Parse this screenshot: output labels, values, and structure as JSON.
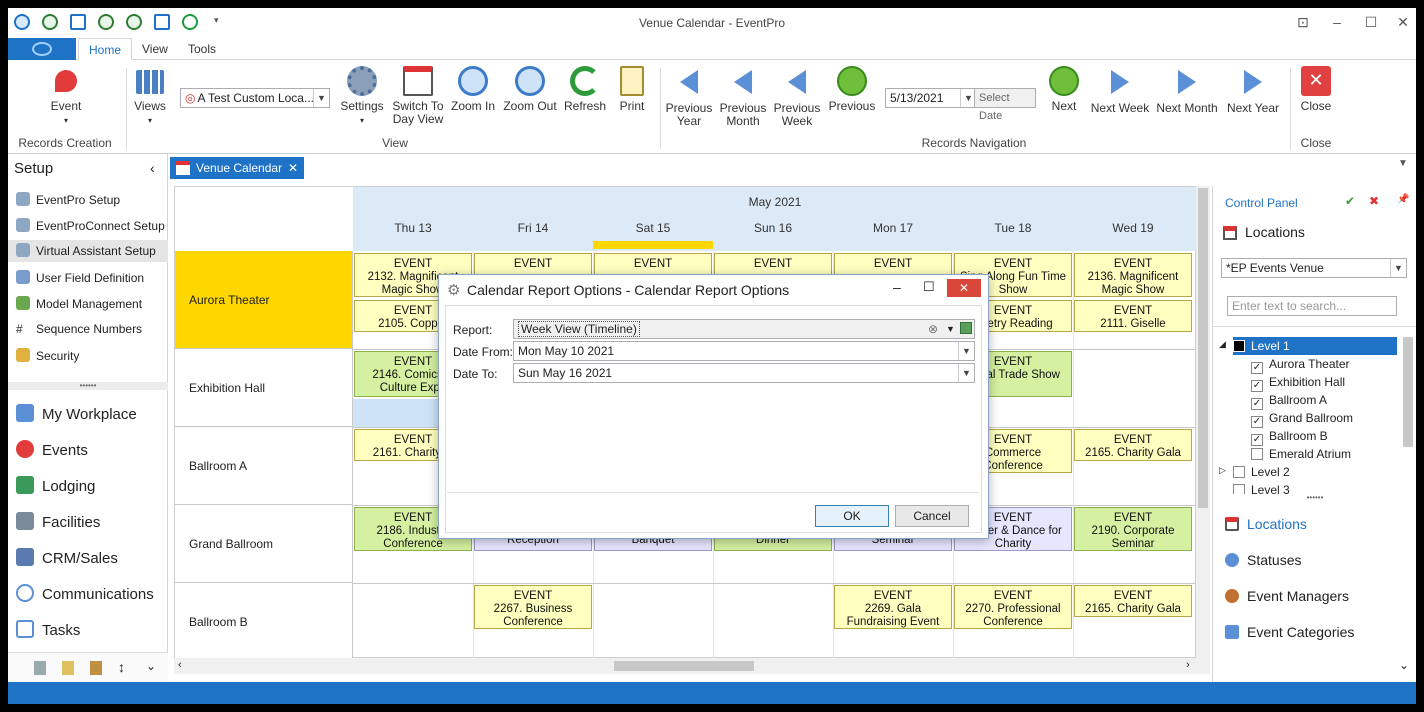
{
  "window": {
    "title": "Venue Calendar - EventPro"
  },
  "tabs": [
    "Home",
    "View",
    "Tools"
  ],
  "ribbon": {
    "event": "Event",
    "views": "Views",
    "view_combo": "A Test Custom Loca...",
    "settings": "Settings",
    "switch_to": "Switch To",
    "day_view": "Day View",
    "zoom_in": "Zoom In",
    "zoom_out": "Zoom Out",
    "refresh": "Refresh",
    "print": "Print",
    "prev_year_1": "Previous",
    "prev_year_2": "Year",
    "prev_month_1": "Previous",
    "prev_month_2": "Month",
    "prev_week_1": "Previous",
    "prev_week_2": "Week",
    "previous": "Previous",
    "date": "5/13/2021",
    "select_date": "Select Date",
    "next": "Next",
    "next_week": "Next Week",
    "next_month": "Next Month",
    "next_year": "Next Year",
    "close": "Close",
    "groups": {
      "records_creation": "Records Creation",
      "view": "View",
      "records_navigation": "Records Navigation",
      "close": "Close"
    }
  },
  "left_panel": {
    "title": "Setup",
    "setup_items": [
      "EventPro Setup",
      "EventProConnect Setup",
      "Virtual Assistant Setup",
      "User Field Definition",
      "Model Management",
      "Sequence Numbers",
      "Security"
    ],
    "nav_items": [
      "My Workplace",
      "Events",
      "Lodging",
      "Facilities",
      "CRM/Sales",
      "Communications",
      "Tasks"
    ]
  },
  "doc_tab": "Venue Calendar",
  "calendar": {
    "month": "May 2021",
    "days": [
      "Thu 13",
      "Fri 14",
      "Sat 15",
      "Sun 16",
      "Mon 17",
      "Tue 18",
      "Wed 19"
    ],
    "venues": [
      "Aurora Theater",
      "Exhibition Hall",
      "Ballroom A",
      "Grand Ballroom",
      "Ballroom B"
    ],
    "label": "EVENT",
    "events": {
      "a1": "2132. Magnificent Magic Show",
      "a2": "2136. Magnificent Magic Show",
      "a3": "2105. Copper",
      "a4": "2111. Giselle",
      "a5": "Poetry Reading",
      "a6": "Sing Along Fun Time Show",
      "e1": "2146. Comics & Culture Expo",
      "e2": "Bridal Trade Show",
      "b1": "2161. Charity G",
      "b2": "2165. Charity Gala",
      "b3": "Commerce Conference",
      "g1": "2186. Industry Conference",
      "g2": "Reception",
      "g3": "Banquet",
      "g4": "Dinner",
      "g5": "Seminar",
      "g6": "Dinner & Dance for Charity",
      "g7": "2190. Corporate Seminar",
      "c1": "2267. Business Conference",
      "c2": "2269. Gala Fundraising Event",
      "c3": "2270. Professional Conference",
      "c4": "2165. Charity Gala"
    }
  },
  "right_panel": {
    "control_panel": "Control Panel",
    "locations_title": "Locations",
    "venue_combo": "*EP Events Venue",
    "search_placeholder": "Enter text to search...",
    "tree": [
      "Level 1",
      "Aurora Theater",
      "Exhibition Hall",
      "Ballroom A",
      "Grand Ballroom",
      "Ballroom B",
      "Emerald Atrium",
      "Level 2",
      "Level 3"
    ],
    "nav": [
      "Locations",
      "Statuses",
      "Event Managers",
      "Event Categories"
    ]
  },
  "dialog": {
    "title": "Calendar Report Options - Calendar Report Options",
    "report_label": "Report:",
    "report_value": "Week View (Timeline)",
    "from_label": "Date From:",
    "from_value": "Mon May 10 2021",
    "to_label": "Date To:",
    "to_value": "Sun May 16 2021",
    "ok": "OK",
    "cancel": "Cancel"
  },
  "colors": {
    "accent": "#1e73c6",
    "event_yellow": "#ffffc0",
    "event_green": "#d4f0a0",
    "selected_venue": "#ffd700"
  }
}
